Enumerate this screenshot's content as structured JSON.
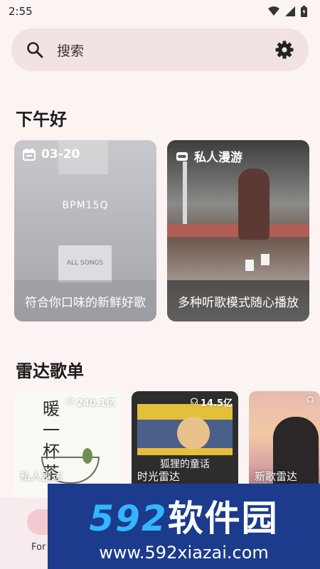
{
  "status_bar": {
    "time": "2:55"
  },
  "search": {
    "placeholder": "搜索"
  },
  "greeting": "下午好",
  "cards": [
    {
      "badge": "03-20",
      "caption": "符合你口味的新鲜好歌",
      "art_text": "BPM15Q",
      "art_sub": "ALL SONGS"
    },
    {
      "badge": "私人漫游",
      "caption": "多种听歌模式随心播放"
    }
  ],
  "radar": {
    "title": "雷达歌单",
    "playlists": [
      {
        "count": "240.1亿",
        "name": "私人雷达",
        "art_text": "暖一杯茶"
      },
      {
        "count": "14.5亿",
        "name": "时光雷达",
        "art_text": "狐狸的童话"
      },
      {
        "count": "",
        "name": "新歌雷达"
      }
    ]
  },
  "bottom_nav": {
    "first_label": "For"
  },
  "watermark": {
    "logo_num": "592",
    "logo_cn": "软件园",
    "url": "www.592xiazai.com"
  },
  "colors": {
    "background": "#fcf3f3",
    "search_bg": "#f1e2e3",
    "accent_pill": "#f4c9cf",
    "watermark_bg": "#1c3b8c"
  }
}
